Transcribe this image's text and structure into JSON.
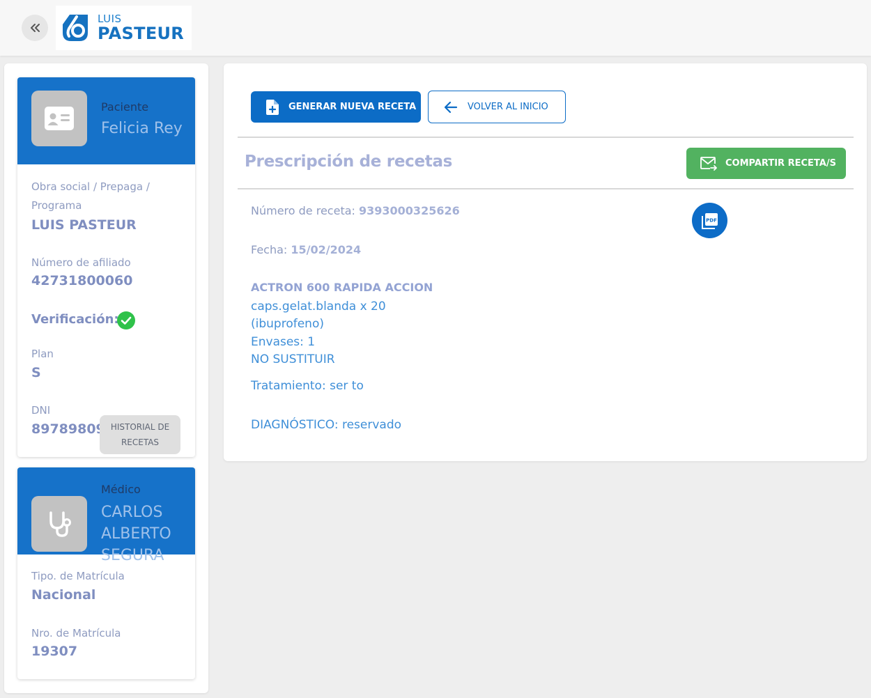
{
  "header": {
    "logo_small": "LUIS",
    "logo_big": "PASTEUR"
  },
  "patient": {
    "head_label": "Paciente",
    "name": "Felicia Rey",
    "obra_label_1": "Obra social / Prepaga /",
    "obra_label_2": "Programa",
    "obra_value": "LUIS PASTEUR",
    "afiliado_label": "Número de afiliado",
    "afiliado_value": "42731800060",
    "verificacion_label": "Verificación:",
    "plan_label": "Plan",
    "plan_value": "S",
    "dni_label": "DNI",
    "dni_value": "89789809",
    "historial_line1": "HISTORIAL DE",
    "historial_line2": "RECETAS"
  },
  "doctor": {
    "head_label": "Médico",
    "name_line1": "CARLOS",
    "name_line2": "ALBERTO",
    "name_line3": "SEGURA",
    "matricula_tipo_label": "Tipo. de Matrícula",
    "matricula_tipo_value": "Nacional",
    "matricula_nro_label": "Nro. de Matrícula",
    "matricula_nro_value": "19307"
  },
  "main": {
    "generar_label": "GENERAR NUEVA RECETA",
    "volver_label": "VOLVER AL INICIO",
    "section_title": "Prescripción de recetas",
    "compartir_label": "COMPARTIR RECETA/S",
    "numero_label": "Número de receta:",
    "numero_value": "9393000325626",
    "fecha_label": "Fecha:",
    "fecha_value": "15/02/2024",
    "drug_name": "ACTRON 600 RAPIDA ACCION",
    "drug_presentation": "caps.gelat.blanda x 20",
    "drug_generic": "(ibuprofeno)",
    "envases": "Envases: 1",
    "sustituir": "NO SUSTITUIR",
    "tratamiento": "Tratamiento: ser to",
    "diagnostico": "DIAGNÓSTICO: reservado"
  },
  "colors": {
    "primary": "#0c6cc6",
    "card_header": "#1672c9",
    "success": "#52b260",
    "verified": "#2fc24a"
  },
  "icons": [
    "double-chevron-left-icon",
    "id-card-icon",
    "check-circle-icon",
    "stethoscope-icon",
    "file-plus-icon",
    "arrow-left-icon",
    "mail-forward-icon",
    "pdf-icon"
  ]
}
